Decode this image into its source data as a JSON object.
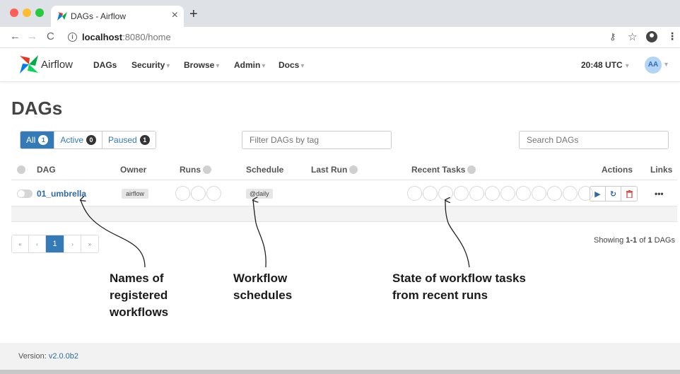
{
  "browser": {
    "tab_title": "DAGs - Airflow",
    "tab_close": "×",
    "new_tab": "+",
    "url_host": "localhost",
    "url_path": ":8080/home"
  },
  "navbar": {
    "brand": "Airflow",
    "items": [
      {
        "label": "DAGs",
        "has_caret": false
      },
      {
        "label": "Security",
        "has_caret": true
      },
      {
        "label": "Browse",
        "has_caret": true
      },
      {
        "label": "Admin",
        "has_caret": true
      },
      {
        "label": "Docs",
        "has_caret": true
      }
    ],
    "time": "20:48 UTC",
    "avatar": "AA"
  },
  "page": {
    "title": "DAGs",
    "filters": [
      {
        "label": "All",
        "count": "1",
        "active": true
      },
      {
        "label": "Active",
        "count": "0",
        "active": false
      },
      {
        "label": "Paused",
        "count": "1",
        "active": false
      }
    ],
    "tag_filter_placeholder": "Filter DAGs by tag",
    "search_placeholder": "Search DAGs"
  },
  "table": {
    "headers": {
      "dag": "DAG",
      "owner": "Owner",
      "runs": "Runs",
      "schedule": "Schedule",
      "last_run": "Last Run",
      "recent_tasks": "Recent Tasks",
      "actions": "Actions",
      "links": "Links"
    },
    "rows": [
      {
        "dag_id": "01_umbrella",
        "owner": "airflow",
        "schedule": "@daily",
        "last_run": "",
        "paused": true
      }
    ],
    "runs_circles": 3,
    "recent_task_circles": 12
  },
  "pagination": {
    "first": "«",
    "prev": "‹",
    "current": "1",
    "next": "›",
    "last": "»",
    "showing_prefix": "Showing ",
    "showing_range": "1-1",
    "showing_of": " of ",
    "showing_total": "1",
    "showing_suffix": " DAGs"
  },
  "annotations": {
    "names": [
      "Names of",
      "registered",
      "workflows"
    ],
    "schedules": [
      "Workflow",
      "schedules"
    ],
    "tasks": [
      "State of workflow tasks",
      "from recent runs"
    ]
  },
  "footer": {
    "version_label": "Version: ",
    "version": "v2.0.0b2"
  },
  "colors": {
    "primary": "#337ab7",
    "link": "#2c6aa8",
    "danger": "#d9534f"
  }
}
